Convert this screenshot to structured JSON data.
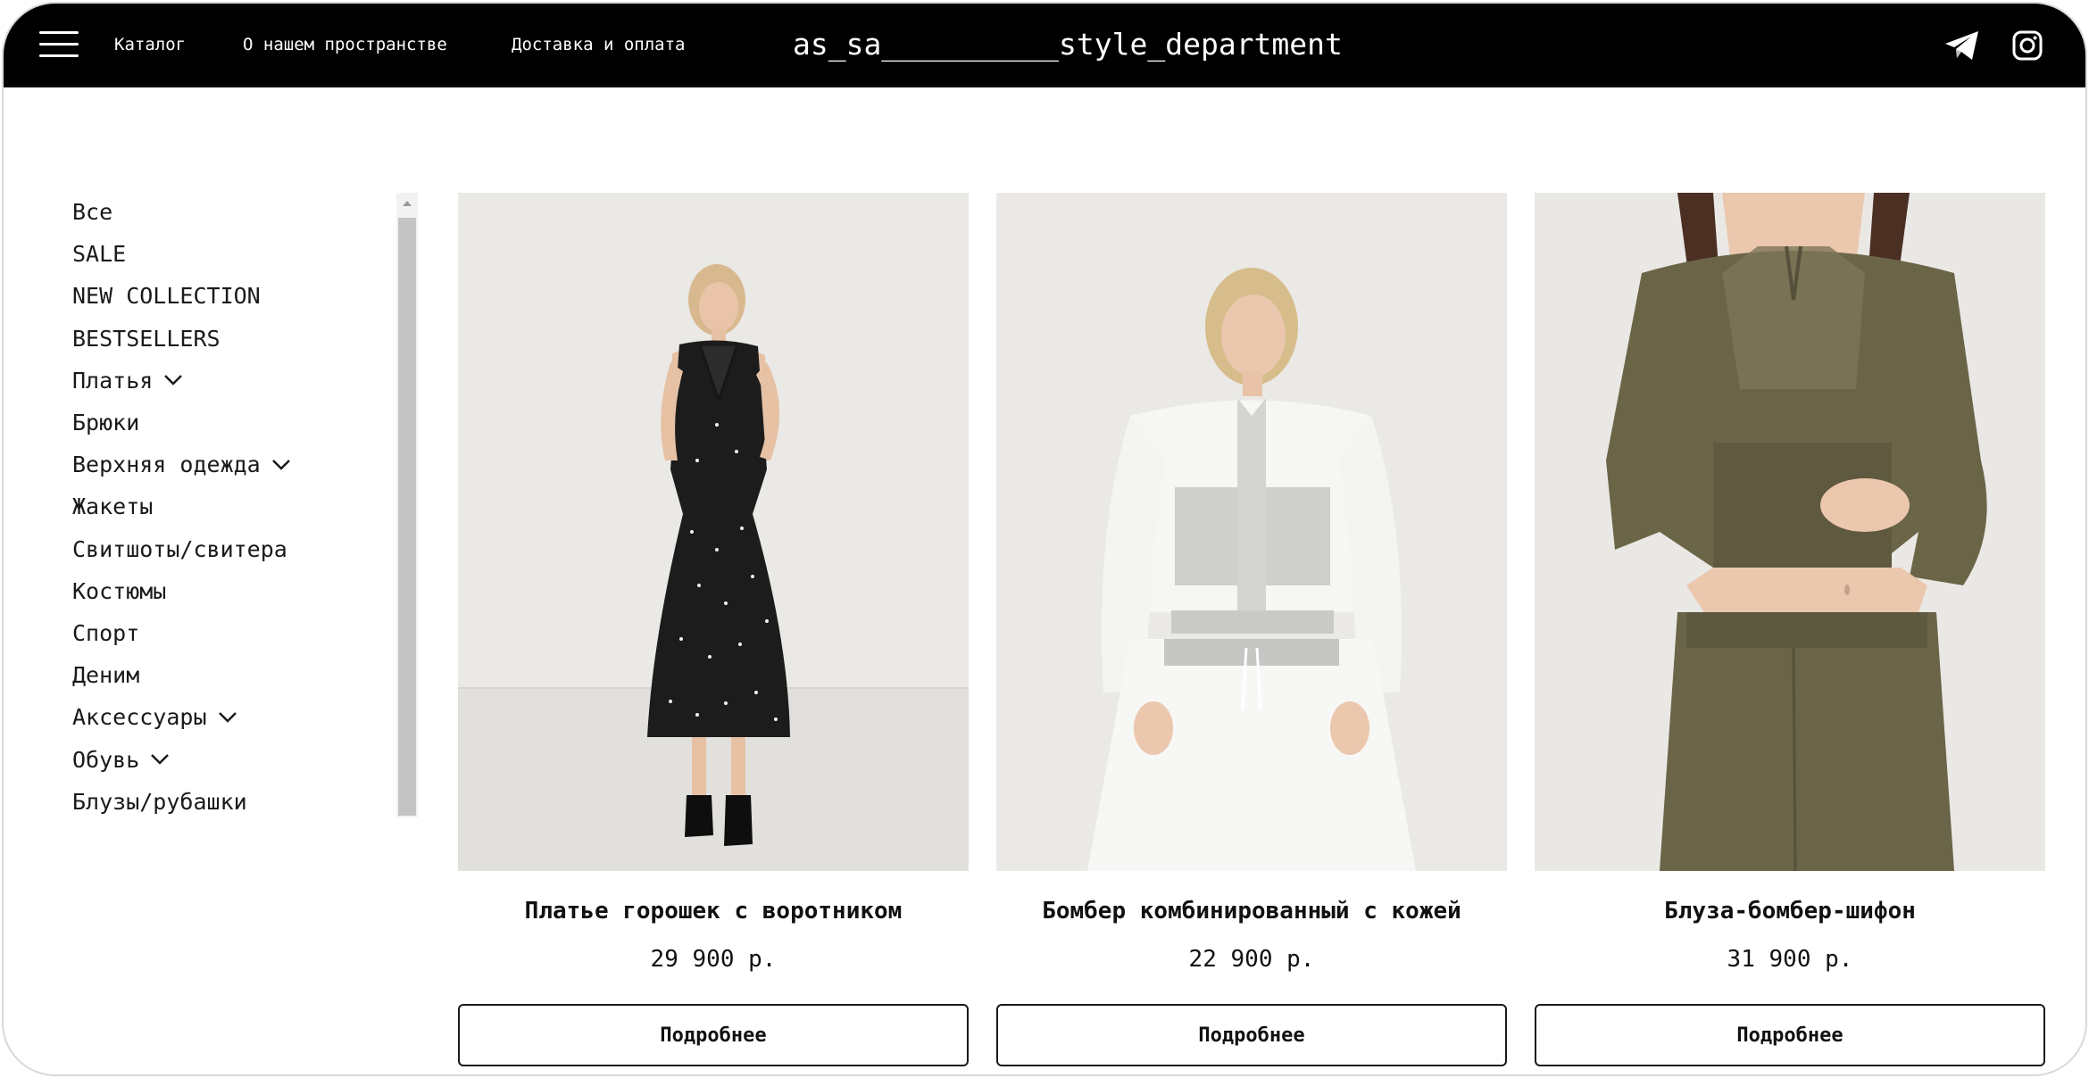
{
  "header": {
    "menu_icon": "hamburger-menu-icon",
    "nav": [
      "Каталог",
      "О нашем пространстве",
      "Доставка и оплата"
    ],
    "brand": "as_sa__________style_department",
    "social_icons": [
      "telegram-icon",
      "instagram-icon"
    ]
  },
  "sidebar": {
    "categories": [
      {
        "label": "Все",
        "expandable": false
      },
      {
        "label": "SALE",
        "expandable": false
      },
      {
        "label": "NEW COLLECTION",
        "expandable": false
      },
      {
        "label": "BESTSELLERS",
        "expandable": false
      },
      {
        "label": "Платья",
        "expandable": true
      },
      {
        "label": "Брюки",
        "expandable": false
      },
      {
        "label": "Верхняя одежда",
        "expandable": true
      },
      {
        "label": "Жакеты",
        "expandable": false
      },
      {
        "label": "Свитшоты/свитера",
        "expandable": false
      },
      {
        "label": "Костюмы",
        "expandable": false
      },
      {
        "label": "Спорт",
        "expandable": false
      },
      {
        "label": "Деним",
        "expandable": false
      },
      {
        "label": "Аксессуары",
        "expandable": true
      },
      {
        "label": "Обувь",
        "expandable": true
      },
      {
        "label": "Блузы/рубашки",
        "expandable": false
      }
    ]
  },
  "products": [
    {
      "title": "Платье горошек с воротником",
      "price": "29 900 р.",
      "button": "Подробнее"
    },
    {
      "title": "Бомбер комбинированный с кожей",
      "price": "22 900 р.",
      "button": "Подробнее"
    },
    {
      "title": "Блуза-бомбер-шифон",
      "price": "31 900 р.",
      "button": "Подробнее"
    }
  ],
  "colors": {
    "header_bg": "#000000",
    "accent": "#000000",
    "photo_bg": "#eae8e5"
  }
}
